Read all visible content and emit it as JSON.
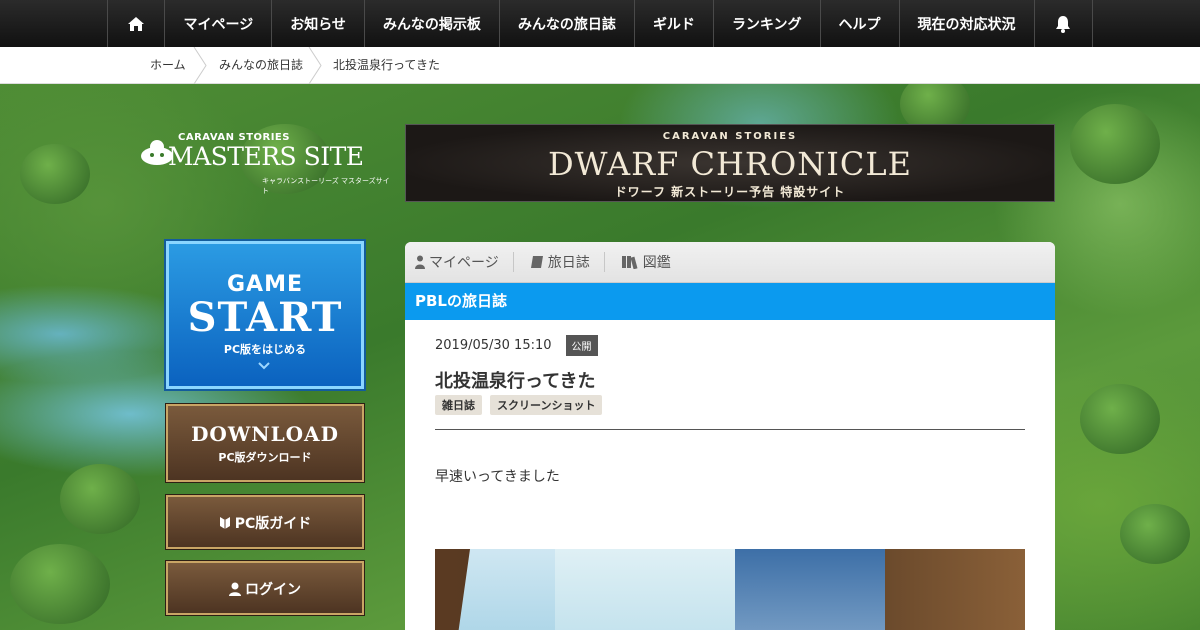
{
  "nav": {
    "items": [
      "マイページ",
      "お知らせ",
      "みんなの掲示板",
      "みんなの旅日誌",
      "ギルド",
      "ランキング",
      "ヘルプ",
      "現在の対応状況"
    ]
  },
  "breadcrumb": {
    "items": [
      "ホーム",
      "みんなの旅日誌",
      "北投温泉行ってきた"
    ]
  },
  "logo": {
    "small": "CARAVAN STORIES",
    "big": "MASTERS SITE",
    "sub": "キャラバンストーリーズ マスターズサイト"
  },
  "banner": {
    "kicker": "CARAVAN STORIES",
    "headline": "DWARF CHRONICLE",
    "sub": "ドワーフ 新ストーリー予告 特設サイト"
  },
  "sidebar": {
    "start": {
      "game": "GAME",
      "start": "START",
      "pc": "PC版をはじめる"
    },
    "download": {
      "big": "DOWNLOAD",
      "small": "PC版ダウンロード"
    },
    "guide": "PC版ガイド",
    "login": "ログイン"
  },
  "panel": {
    "tabs": [
      "マイページ",
      "旅日誌",
      "図鑑"
    ],
    "title": "PBLの旅日誌",
    "date": "2019/05/30 15:10",
    "status": "公開",
    "post_title": "北投温泉行ってきた",
    "tags": [
      "雑日誌",
      "スクリーンショット"
    ],
    "body": "早速いってきました"
  },
  "colors": {
    "accent": "#0b9aef",
    "nav_bg": "#1a1a1a",
    "start_button": "#1a7fd6",
    "wood_button": "#5e4230"
  }
}
